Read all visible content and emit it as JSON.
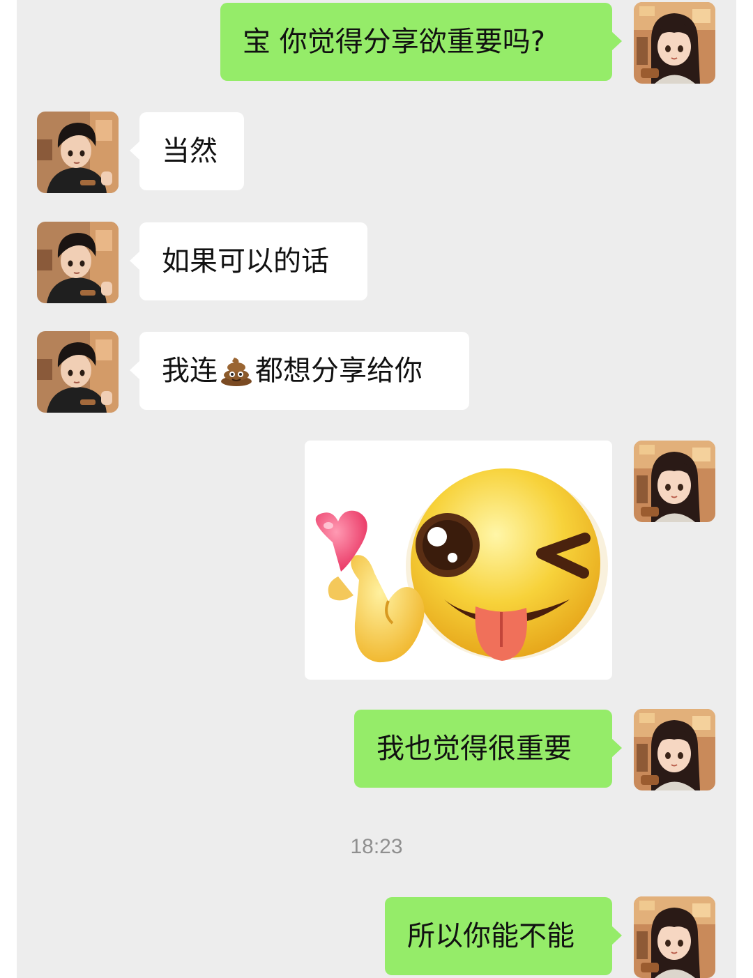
{
  "messages": [
    {
      "side": "sent",
      "type": "text",
      "text": "宝 你觉得分享欲重要吗?"
    },
    {
      "side": "received",
      "type": "text",
      "text": "当然"
    },
    {
      "side": "received",
      "type": "text",
      "text": "如果可以的话"
    },
    {
      "side": "received",
      "type": "text",
      "text_before": "我连",
      "emoji": "poop-emoji",
      "text_after": "都想分享给你"
    },
    {
      "side": "sent",
      "type": "sticker",
      "sticker": "wink-tongue-finger-heart-emoji"
    },
    {
      "side": "sent",
      "type": "text",
      "text": "我也觉得很重要"
    },
    {
      "side": "sent",
      "type": "text",
      "text": "所以你能不能"
    }
  ],
  "timestamp": "18:23",
  "colors": {
    "chat_background": "#ededed",
    "sent_bubble": "#95ec69",
    "received_bubble": "#ffffff",
    "timestamp_text": "#8f8f8f"
  }
}
